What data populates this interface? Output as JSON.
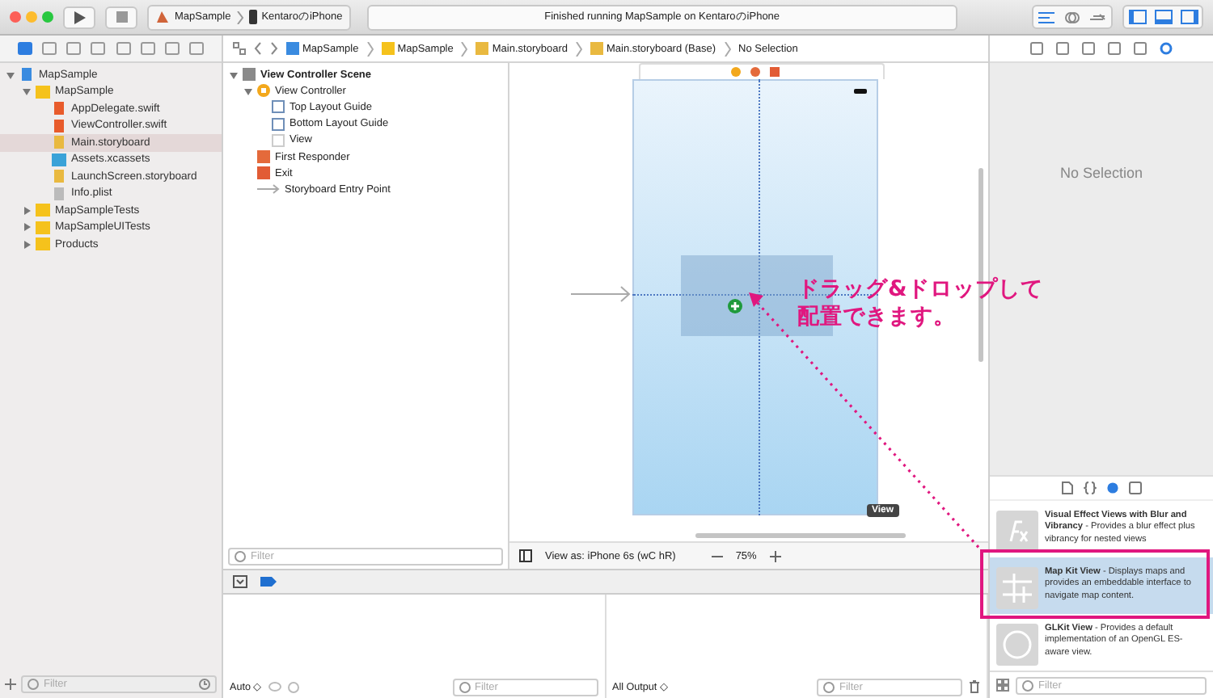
{
  "toolbar": {
    "scheme": "MapSample",
    "device": "KentaroのiPhone",
    "status": "Finished running MapSample on KentaroのiPhone"
  },
  "navigator": {
    "tree": [
      {
        "label": "MapSample",
        "kind": "project",
        "expanded": true,
        "selected": false,
        "children": [
          {
            "label": "MapSample",
            "kind": "folder",
            "expanded": true,
            "selected": false,
            "children": [
              {
                "label": "AppDelegate.swift",
                "kind": "swift",
                "selected": false
              },
              {
                "label": "ViewController.swift",
                "kind": "swift",
                "selected": false
              },
              {
                "label": "Main.storyboard",
                "kind": "storyboard",
                "selected": true
              },
              {
                "label": "Assets.xcassets",
                "kind": "assets",
                "selected": false
              },
              {
                "label": "LaunchScreen.storyboard",
                "kind": "storyboard",
                "selected": false
              },
              {
                "label": "Info.plist",
                "kind": "plist",
                "selected": false
              }
            ]
          },
          {
            "label": "MapSampleTests",
            "kind": "folder",
            "expanded": false,
            "selected": false
          },
          {
            "label": "MapSampleUITests",
            "kind": "folder",
            "expanded": false,
            "selected": false
          },
          {
            "label": "Products",
            "kind": "folder",
            "expanded": false,
            "selected": false
          }
        ]
      }
    ],
    "filter_placeholder": "Filter"
  },
  "jump_bar": [
    {
      "label": "MapSample",
      "kind": "project"
    },
    {
      "label": "MapSample",
      "kind": "folder"
    },
    {
      "label": "Main.storyboard",
      "kind": "storyboard"
    },
    {
      "label": "Main.storyboard (Base)",
      "kind": "storyboard"
    },
    {
      "label": "No Selection",
      "kind": "none"
    }
  ],
  "outline": {
    "tree": [
      {
        "label": "View Controller Scene",
        "kind": "scene",
        "expanded": true,
        "children": [
          {
            "label": "View Controller",
            "kind": "controller",
            "expanded": true,
            "children": [
              {
                "label": "Top Layout Guide",
                "kind": "guide"
              },
              {
                "label": "Bottom Layout Guide",
                "kind": "guide"
              },
              {
                "label": "View",
                "kind": "view"
              }
            ]
          },
          {
            "label": "First Responder",
            "kind": "responder"
          },
          {
            "label": "Exit",
            "kind": "exit"
          },
          {
            "label": "Storyboard Entry Point",
            "kind": "entry"
          }
        ]
      }
    ],
    "filter_placeholder": "Filter"
  },
  "canvas": {
    "view_badge": "View",
    "view_as": "View as: iPhone 6s (wC hR)",
    "zoom": "75%"
  },
  "debug": {
    "variables_mode": "Auto ◇",
    "variables_filter": "Filter",
    "console_mode": "All Output ◇",
    "console_filter": "Filter"
  },
  "inspector": {
    "message": "No Selection"
  },
  "library": {
    "tabs": [
      {
        "kind": "file",
        "selected": false
      },
      {
        "kind": "code",
        "selected": false
      },
      {
        "kind": "object",
        "selected": true
      },
      {
        "kind": "media",
        "selected": false
      }
    ],
    "items": [
      {
        "kind": "effect",
        "text": "**Visual Effect Views with Blur and Vibrancy** - Provides a blur effect plus vibrancy for nested views",
        "selected": false
      },
      {
        "kind": "map",
        "text": "**Map Kit View** - Displays maps and provides an embeddable interface to navigate map content.",
        "selected": true
      },
      {
        "kind": "glkit",
        "text": "**GLKit View** - Provides a default implementation of an OpenGL ES-aware view.",
        "selected": false
      }
    ],
    "filter_placeholder": "Filter"
  },
  "annotation": {
    "lines": [
      "ドラッグ&ドロップして",
      "配置できます。"
    ]
  }
}
